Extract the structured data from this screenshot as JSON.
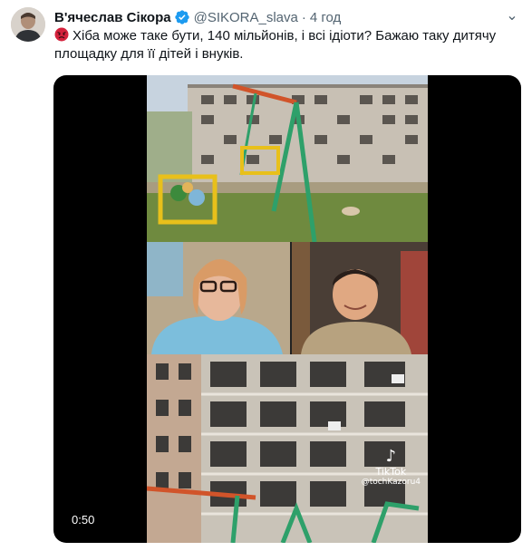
{
  "author": {
    "name": "В'ячеслав Сікора",
    "handle": "@SIKORA_slava",
    "separator": "·",
    "time": "4 год"
  },
  "tweet": {
    "text": "Хіба може таке бути, 140 мільйонів, і всі ідіоти? Бажаю таку дитячу площадку для її дітей і внуків."
  },
  "video": {
    "duration": "0:50",
    "watermark": "TikTok",
    "watermark_user": "@tochKazoru4"
  },
  "icons": {
    "verified": "verified-badge-icon",
    "emoji": "angry-face-icon",
    "more": "more-icon",
    "tiktok": "tiktok-logo-icon"
  },
  "colors": {
    "verified": "#1d9bf0",
    "text": "#0f1419",
    "muted": "#536471"
  }
}
